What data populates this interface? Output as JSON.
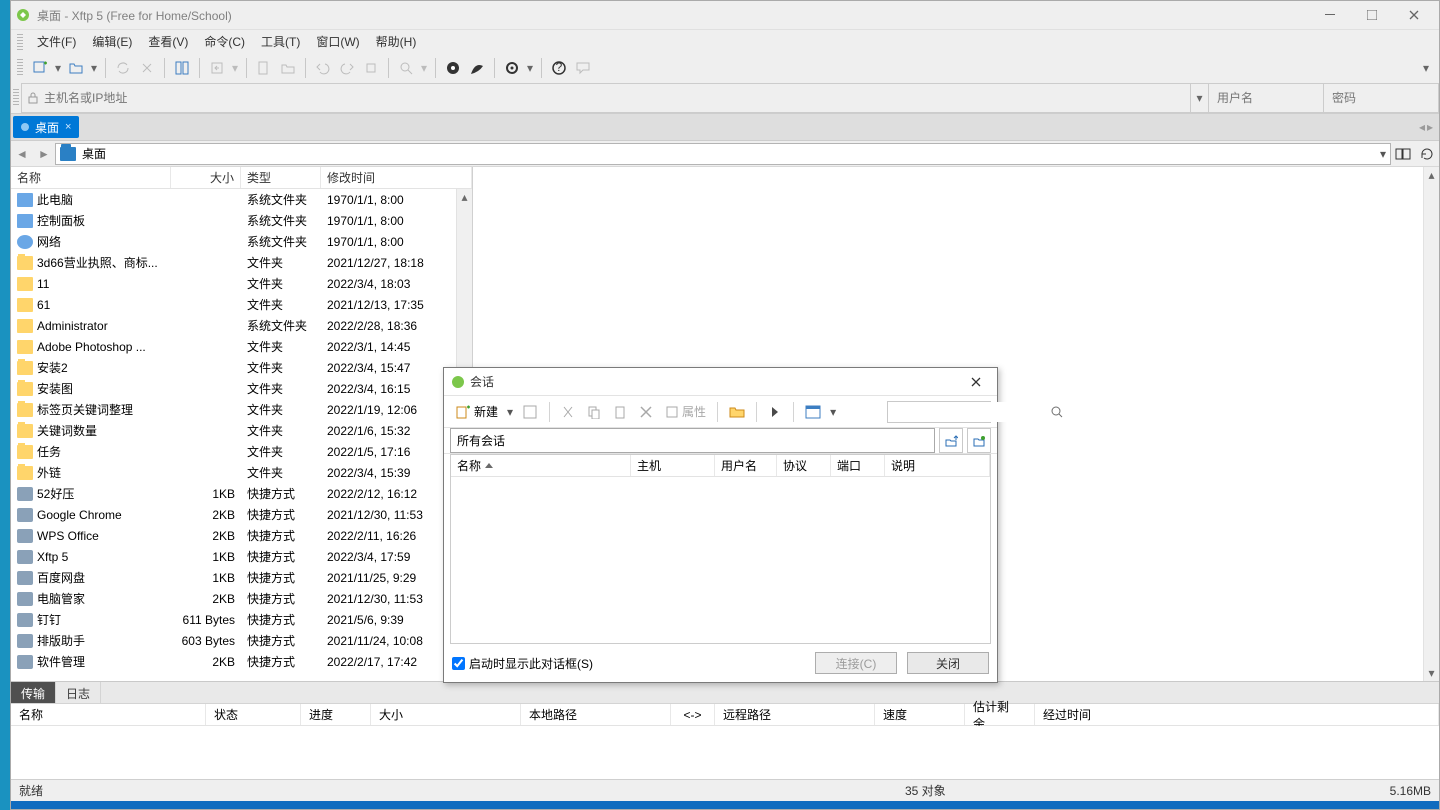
{
  "titlebar": {
    "title": "桌面 - Xftp 5 (Free for Home/School)"
  },
  "menubar": [
    "文件(F)",
    "编辑(E)",
    "查看(V)",
    "命令(C)",
    "工具(T)",
    "窗口(W)",
    "帮助(H)"
  ],
  "addr": {
    "placeholder": "主机名或IP地址",
    "user_ph": "用户名",
    "pass_ph": "密码"
  },
  "doctab": {
    "label": "桌面"
  },
  "path": {
    "label": "桌面"
  },
  "columns": {
    "name": "名称",
    "size": "大小",
    "type": "类型",
    "date": "修改时间"
  },
  "files": [
    {
      "icon": "pc",
      "name": "此电脑",
      "size": "",
      "type": "系统文件夹",
      "date": "1970/1/1, 8:00"
    },
    {
      "icon": "panel",
      "name": "控制面板",
      "size": "",
      "type": "系统文件夹",
      "date": "1970/1/1, 8:00"
    },
    {
      "icon": "net",
      "name": "网络",
      "size": "",
      "type": "系统文件夹",
      "date": "1970/1/1, 8:00"
    },
    {
      "icon": "folder",
      "name": "3d66营业执照、商标...",
      "size": "",
      "type": "文件夹",
      "date": "2021/12/27, 18:18"
    },
    {
      "icon": "folder",
      "name": "11",
      "size": "",
      "type": "文件夹",
      "date": "2022/3/4, 18:03"
    },
    {
      "icon": "folder",
      "name": "61",
      "size": "",
      "type": "文件夹",
      "date": "2021/12/13, 17:35"
    },
    {
      "icon": "folder",
      "name": "Administrator",
      "size": "",
      "type": "系统文件夹",
      "date": "2022/2/28, 18:36"
    },
    {
      "icon": "folder",
      "name": "Adobe Photoshop ...",
      "size": "",
      "type": "文件夹",
      "date": "2022/3/1, 14:45"
    },
    {
      "icon": "folder",
      "name": "安装2",
      "size": "",
      "type": "文件夹",
      "date": "2022/3/4, 15:47"
    },
    {
      "icon": "folder",
      "name": "安装图",
      "size": "",
      "type": "文件夹",
      "date": "2022/3/4, 16:15"
    },
    {
      "icon": "folder",
      "name": "标签页关键词整理",
      "size": "",
      "type": "文件夹",
      "date": "2022/1/19, 12:06"
    },
    {
      "icon": "folder",
      "name": "关键词数量",
      "size": "",
      "type": "文件夹",
      "date": "2022/1/6, 15:32"
    },
    {
      "icon": "folder",
      "name": "任务",
      "size": "",
      "type": "文件夹",
      "date": "2022/1/5, 17:16"
    },
    {
      "icon": "folder",
      "name": "外链",
      "size": "",
      "type": "文件夹",
      "date": "2022/3/4, 15:39"
    },
    {
      "icon": "app",
      "name": "52好压",
      "size": "1KB",
      "type": "快捷方式",
      "date": "2022/2/12, 16:12"
    },
    {
      "icon": "app",
      "name": "Google Chrome",
      "size": "2KB",
      "type": "快捷方式",
      "date": "2021/12/30, 11:53"
    },
    {
      "icon": "app",
      "name": "WPS Office",
      "size": "2KB",
      "type": "快捷方式",
      "date": "2022/2/11, 16:26"
    },
    {
      "icon": "app",
      "name": "Xftp 5",
      "size": "1KB",
      "type": "快捷方式",
      "date": "2022/3/4, 17:59"
    },
    {
      "icon": "app",
      "name": "百度网盘",
      "size": "1KB",
      "type": "快捷方式",
      "date": "2021/11/25, 9:29"
    },
    {
      "icon": "app",
      "name": "电脑管家",
      "size": "2KB",
      "type": "快捷方式",
      "date": "2021/12/30, 11:53"
    },
    {
      "icon": "app",
      "name": "钉钉",
      "size": "611 Bytes",
      "type": "快捷方式",
      "date": "2021/5/6, 9:39"
    },
    {
      "icon": "app",
      "name": "排版助手",
      "size": "603 Bytes",
      "type": "快捷方式",
      "date": "2021/11/24, 10:08"
    },
    {
      "icon": "app",
      "name": "软件管理",
      "size": "2KB",
      "type": "快捷方式",
      "date": "2022/2/17, 17:42"
    }
  ],
  "transfer": {
    "tabs": [
      "传输",
      "日志"
    ],
    "cols": [
      "名称",
      "状态",
      "进度",
      "大小",
      "本地路径",
      "<->",
      "远程路径",
      "速度",
      "估计剩余...",
      "经过时间"
    ]
  },
  "status": {
    "ready": "就绪",
    "objects": "35 对象",
    "size": "5.16MB"
  },
  "sessions_dialog": {
    "title": "会话",
    "new_btn": "新建",
    "props_btn": "属性",
    "path": "所有会话",
    "cols": [
      "名称",
      "主机",
      "用户名",
      "协议",
      "端口",
      "说明"
    ],
    "show_on_start": "启动时显示此对话框(S)",
    "connect": "连接(C)",
    "close": "关闭"
  }
}
